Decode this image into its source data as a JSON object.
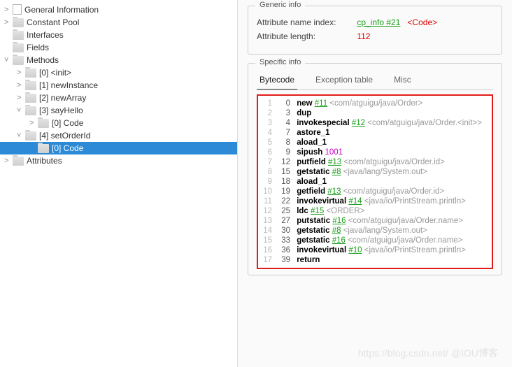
{
  "tree": {
    "items": [
      {
        "indent": 0,
        "chev": ">",
        "icon": "doc",
        "label": "General Information"
      },
      {
        "indent": 0,
        "chev": ">",
        "icon": "folder",
        "label": "Constant Pool"
      },
      {
        "indent": 0,
        "chev": "",
        "icon": "folder",
        "label": "Interfaces"
      },
      {
        "indent": 0,
        "chev": "",
        "icon": "folder",
        "label": "Fields"
      },
      {
        "indent": 0,
        "chev": "v",
        "icon": "folder",
        "label": "Methods"
      },
      {
        "indent": 1,
        "chev": ">",
        "icon": "folder",
        "label": "[0] <init>"
      },
      {
        "indent": 1,
        "chev": ">",
        "icon": "folder",
        "label": "[1] newInstance"
      },
      {
        "indent": 1,
        "chev": ">",
        "icon": "folder",
        "label": "[2] newArray"
      },
      {
        "indent": 1,
        "chev": "v",
        "icon": "folder",
        "label": "[3] sayHello"
      },
      {
        "indent": 2,
        "chev": ">",
        "icon": "folder",
        "label": "[0] Code"
      },
      {
        "indent": 1,
        "chev": "v",
        "icon": "folder",
        "label": "[4] setOrderId"
      },
      {
        "indent": 2,
        "chev": "",
        "icon": "folder",
        "label": "[0] Code",
        "selected": true
      },
      {
        "indent": 0,
        "chev": ">",
        "icon": "folder",
        "label": "Attributes"
      }
    ]
  },
  "generic": {
    "legend": "Generic info",
    "attrNameLabel": "Attribute name index:",
    "attrNameLink": "cp_info #21",
    "attrNameTag": "<Code>",
    "attrLenLabel": "Attribute length:",
    "attrLenVal": "112"
  },
  "specific": {
    "legend": "Specific info",
    "tabs": [
      "Bytecode",
      "Exception table",
      "Misc"
    ],
    "bytecode": [
      {
        "ln": 1,
        "off": 0,
        "op": "new",
        "ref": "#11",
        "cmt": "<com/atguigu/java/Order>"
      },
      {
        "ln": 2,
        "off": 3,
        "op": "dup"
      },
      {
        "ln": 3,
        "off": 4,
        "op": "invokespecial",
        "ref": "#12",
        "cmt": "<com/atguigu/java/Order.<init>>"
      },
      {
        "ln": 4,
        "off": 7,
        "op": "astore_1"
      },
      {
        "ln": 5,
        "off": 8,
        "op": "aload_1"
      },
      {
        "ln": 6,
        "off": 9,
        "op": "sipush",
        "arg": "1001"
      },
      {
        "ln": 7,
        "off": 12,
        "op": "putfield",
        "ref": "#13",
        "cmt": "<com/atguigu/java/Order.id>"
      },
      {
        "ln": 8,
        "off": 15,
        "op": "getstatic",
        "ref": "#8",
        "cmt": "<java/lang/System.out>"
      },
      {
        "ln": 9,
        "off": 18,
        "op": "aload_1"
      },
      {
        "ln": 10,
        "off": 19,
        "op": "getfield",
        "ref": "#13",
        "cmt": "<com/atguigu/java/Order.id>"
      },
      {
        "ln": 11,
        "off": 22,
        "op": "invokevirtual",
        "ref": "#14",
        "cmt": "<java/io/PrintStream.println>"
      },
      {
        "ln": 12,
        "off": 25,
        "op": "ldc",
        "ref": "#15",
        "cmt": "<ORDER>"
      },
      {
        "ln": 13,
        "off": 27,
        "op": "putstatic",
        "ref": "#16",
        "cmt": "<com/atguigu/java/Order.name>"
      },
      {
        "ln": 14,
        "off": 30,
        "op": "getstatic",
        "ref": "#8",
        "cmt": "<java/lang/System.out>"
      },
      {
        "ln": 15,
        "off": 33,
        "op": "getstatic",
        "ref": "#16",
        "cmt": "<com/atguigu/java/Order.name>"
      },
      {
        "ln": 16,
        "off": 36,
        "op": "invokevirtual",
        "ref": "#10",
        "cmt": "<java/io/PrintStream.println>"
      },
      {
        "ln": 17,
        "off": 39,
        "op": "return"
      }
    ]
  },
  "watermark": "https://blog.csdn.net/ @IOU博客"
}
